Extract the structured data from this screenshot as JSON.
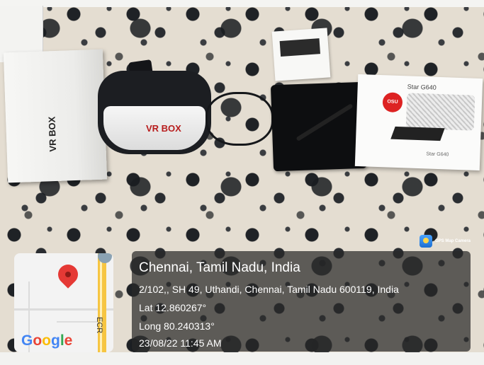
{
  "photo": {
    "vr_box_label": "VR BOX",
    "headset_label": "VR BOX",
    "tablet_box_model": "Star G640",
    "tablet_box_badge": "OSU",
    "tablet_box_model_side": "Star G640"
  },
  "overlay": {
    "app_name": "GPS Map Camera",
    "location_title": "Chennai, Tamil Nadu, India",
    "address": "2/102,, SH 49, Uthandi, Chennai, Tamil Nadu 600119, India",
    "latitude": "Lat 12.860267°",
    "longitude": "Long 80.240313°",
    "timestamp": "23/08/22 11:45 AM"
  },
  "map": {
    "road_label": "ECR",
    "logo_letters": [
      "G",
      "o",
      "o",
      "g",
      "l",
      "e"
    ],
    "logo_colors": [
      "#4285F4",
      "#EA4335",
      "#FBBC05",
      "#4285F4",
      "#34A853",
      "#EA4335"
    ],
    "pin_icon": "location-pin-icon"
  }
}
